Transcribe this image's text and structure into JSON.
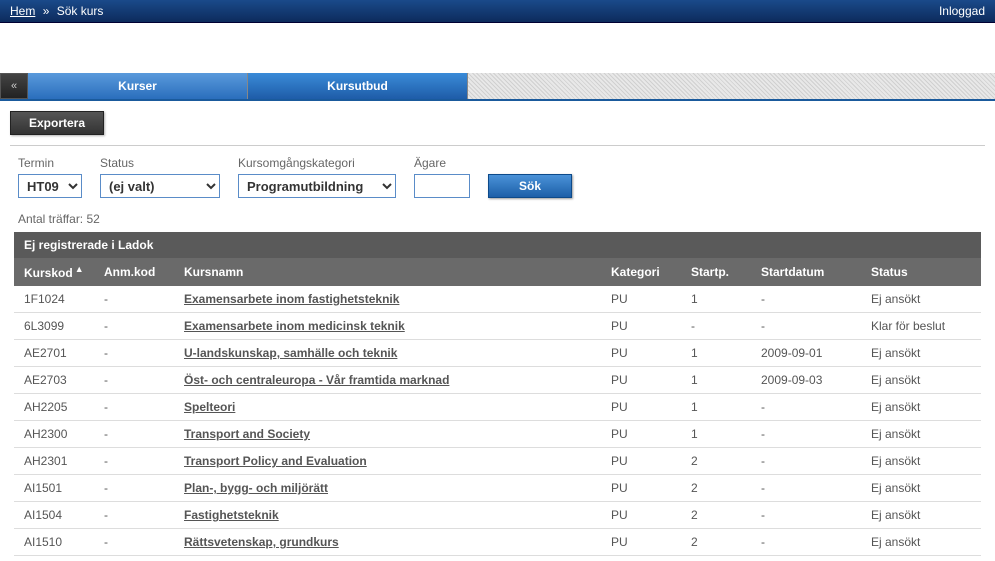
{
  "breadcrumb": {
    "home": "Hem",
    "current": "Sök kurs",
    "login": "Inloggad"
  },
  "tabs": {
    "kurser": "Kurser",
    "kursutbud": "Kursutbud",
    "back": "«"
  },
  "toolbar": {
    "export": "Exportera"
  },
  "filters": {
    "termin": {
      "label": "Termin",
      "value": "HT09"
    },
    "status": {
      "label": "Status",
      "value": "(ej valt)"
    },
    "kategori": {
      "label": "Kursomgångskategori",
      "value": "Programutbildning"
    },
    "agare": {
      "label": "Ägare",
      "value": ""
    },
    "search": "Sök"
  },
  "results": {
    "label": "Antal träffar:",
    "count": "52"
  },
  "table": {
    "section": "Ej registrerade i Ladok",
    "headers": {
      "kurskod": "Kurskod",
      "anmkod": "Anm.kod",
      "kursnamn": "Kursnamn",
      "kategori": "Kategori",
      "startp": "Startp.",
      "startdatum": "Startdatum",
      "status": "Status"
    },
    "rows": [
      {
        "kurskod": "1F1024",
        "anmkod": "-",
        "kursnamn": "Examensarbete inom fastighetsteknik",
        "kategori": "PU",
        "startp": "1",
        "startdatum": "-",
        "status": "Ej ansökt"
      },
      {
        "kurskod": "6L3099",
        "anmkod": "-",
        "kursnamn": "Examensarbete inom medicinsk teknik",
        "kategori": "PU",
        "startp": "-",
        "startdatum": "-",
        "status": "Klar för beslut"
      },
      {
        "kurskod": "AE2701",
        "anmkod": "-",
        "kursnamn": "U-landskunskap, samhälle och teknik",
        "kategori": "PU",
        "startp": "1",
        "startdatum": "2009-09-01",
        "status": "Ej ansökt"
      },
      {
        "kurskod": "AE2703",
        "anmkod": "-",
        "kursnamn": "Öst- och centraleuropa - Vår framtida marknad",
        "kategori": "PU",
        "startp": "1",
        "startdatum": "2009-09-03",
        "status": "Ej ansökt"
      },
      {
        "kurskod": "AH2205",
        "anmkod": "-",
        "kursnamn": "Spelteori",
        "kategori": "PU",
        "startp": "1",
        "startdatum": "-",
        "status": "Ej ansökt"
      },
      {
        "kurskod": "AH2300",
        "anmkod": "-",
        "kursnamn": "Transport and Society",
        "kategori": "PU",
        "startp": "1",
        "startdatum": "-",
        "status": "Ej ansökt"
      },
      {
        "kurskod": "AH2301",
        "anmkod": "-",
        "kursnamn": "Transport Policy and Evaluation",
        "kategori": "PU",
        "startp": "2",
        "startdatum": "-",
        "status": "Ej ansökt"
      },
      {
        "kurskod": "AI1501",
        "anmkod": "-",
        "kursnamn": "Plan-, bygg- och miljörätt",
        "kategori": "PU",
        "startp": "2",
        "startdatum": "-",
        "status": "Ej ansökt"
      },
      {
        "kurskod": "AI1504",
        "anmkod": "-",
        "kursnamn": "Fastighetsteknik",
        "kategori": "PU",
        "startp": "2",
        "startdatum": "-",
        "status": "Ej ansökt"
      },
      {
        "kurskod": "AI1510",
        "anmkod": "-",
        "kursnamn": "Rättsvetenskap, grundkurs",
        "kategori": "PU",
        "startp": "2",
        "startdatum": "-",
        "status": "Ej ansökt"
      }
    ]
  }
}
